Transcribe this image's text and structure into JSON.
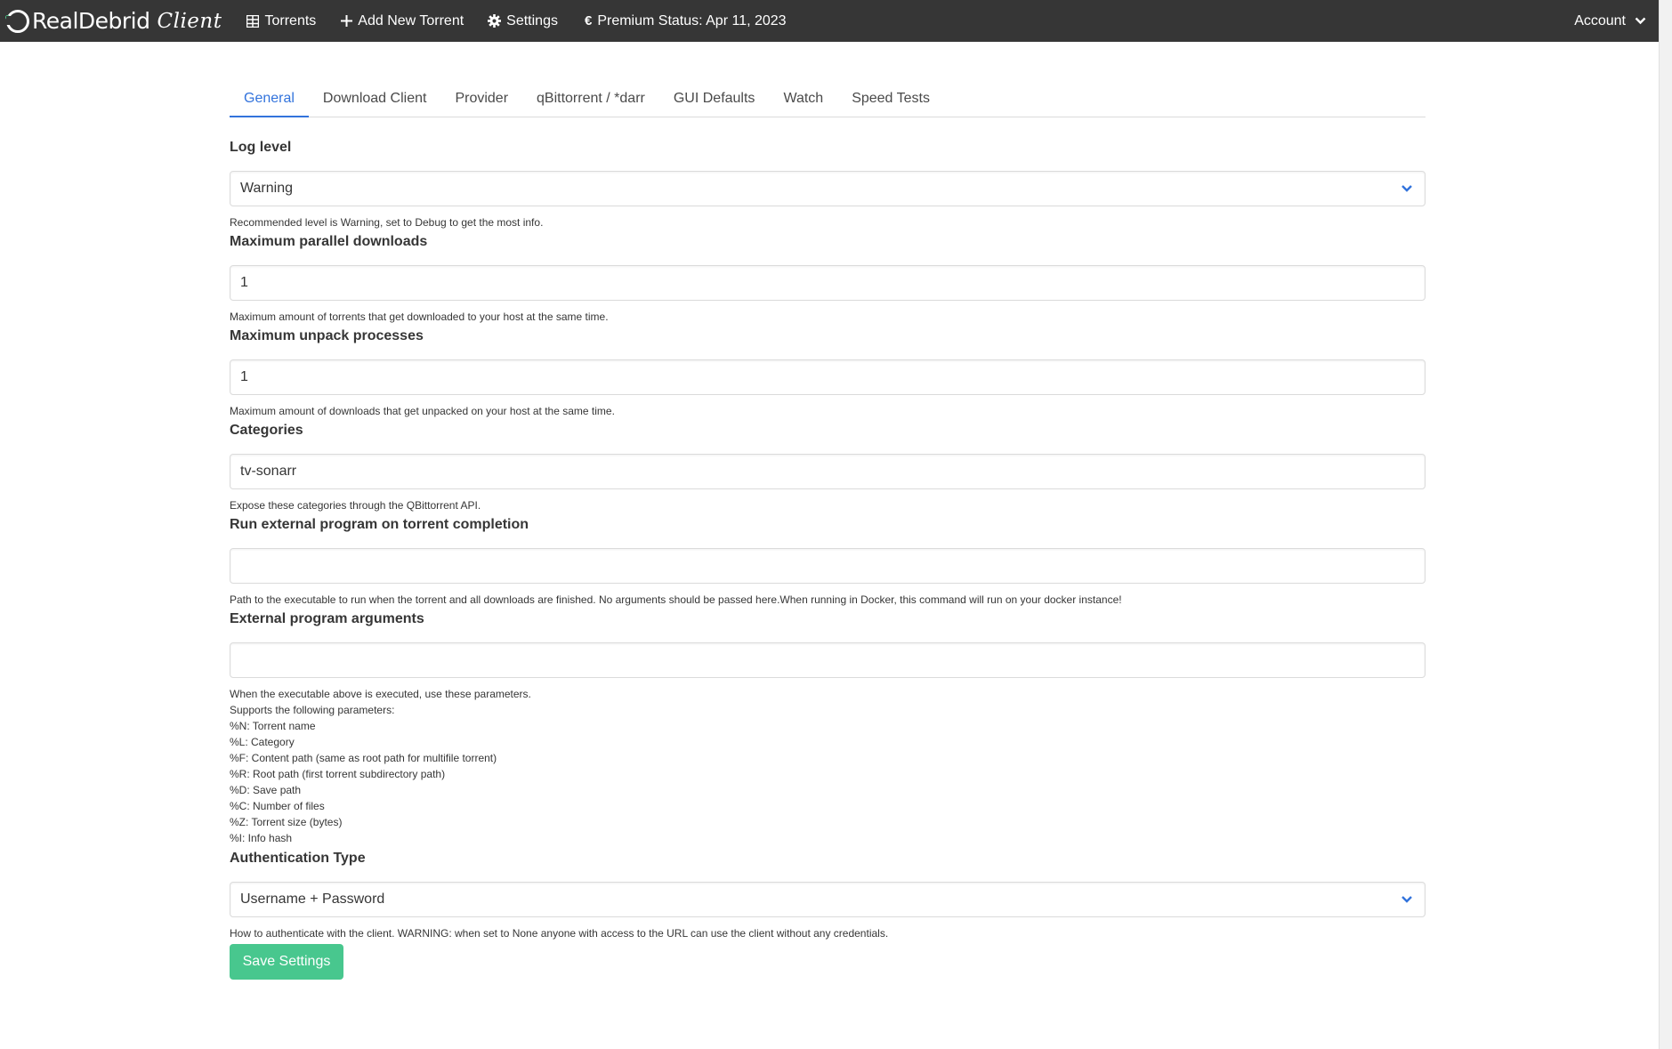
{
  "navbar": {
    "brand_name": "RealDebrid",
    "brand_suffix": "Client",
    "torrents_label": "Torrents",
    "add_torrent_label": "Add New Torrent",
    "settings_label": "Settings",
    "premium_label": "Premium Status: Apr 11, 2023",
    "account_label": "Account"
  },
  "tabs": [
    "General",
    "Download Client",
    "Provider",
    "qBittorrent / *darr",
    "GUI Defaults",
    "Watch",
    "Speed Tests"
  ],
  "active_tab": "General",
  "fields": {
    "log_level": {
      "label": "Log level",
      "value": "Warning",
      "help": "Recommended level is Warning, set to Debug to get the most info."
    },
    "max_parallel_downloads": {
      "label": "Maximum parallel downloads",
      "value": "1",
      "help": "Maximum amount of torrents that get downloaded to your host at the same time."
    },
    "max_unpack_processes": {
      "label": "Maximum unpack processes",
      "value": "1",
      "help": "Maximum amount of downloads that get unpacked on your host at the same time."
    },
    "categories": {
      "label": "Categories",
      "value": "tv-sonarr",
      "help": "Expose these categories through the QBittorrent API."
    },
    "run_external_program": {
      "label": "Run external program on torrent completion",
      "value": "",
      "help": "Path to the executable to run when the torrent and all downloads are finished. No arguments should be passed here.When running in Docker, this command will run on your docker instance!"
    },
    "external_program_arguments": {
      "label": "External program arguments",
      "value": "",
      "help_lines": [
        "When the executable above is executed, use these parameters.",
        "Supports the following parameters:",
        "%N: Torrent name",
        "%L: Category",
        "%F: Content path (same as root path for multifile torrent)",
        "%R: Root path (first torrent subdirectory path)",
        "%D: Save path",
        "%C: Number of files",
        "%Z: Torrent size (bytes)",
        "%I: Info hash"
      ]
    },
    "authentication_type": {
      "label": "Authentication Type",
      "value": "Username + Password",
      "help": "How to authenticate with the client. WARNING: when set to None anyone with access to the URL can use the client without any credentials."
    }
  },
  "save_button_label": "Save Settings",
  "colors": {
    "navbar_bg": "#363636",
    "active_tab": "#3273dc",
    "save_button": "#48c78e",
    "brand_ring_accent": "#4ec48a"
  }
}
